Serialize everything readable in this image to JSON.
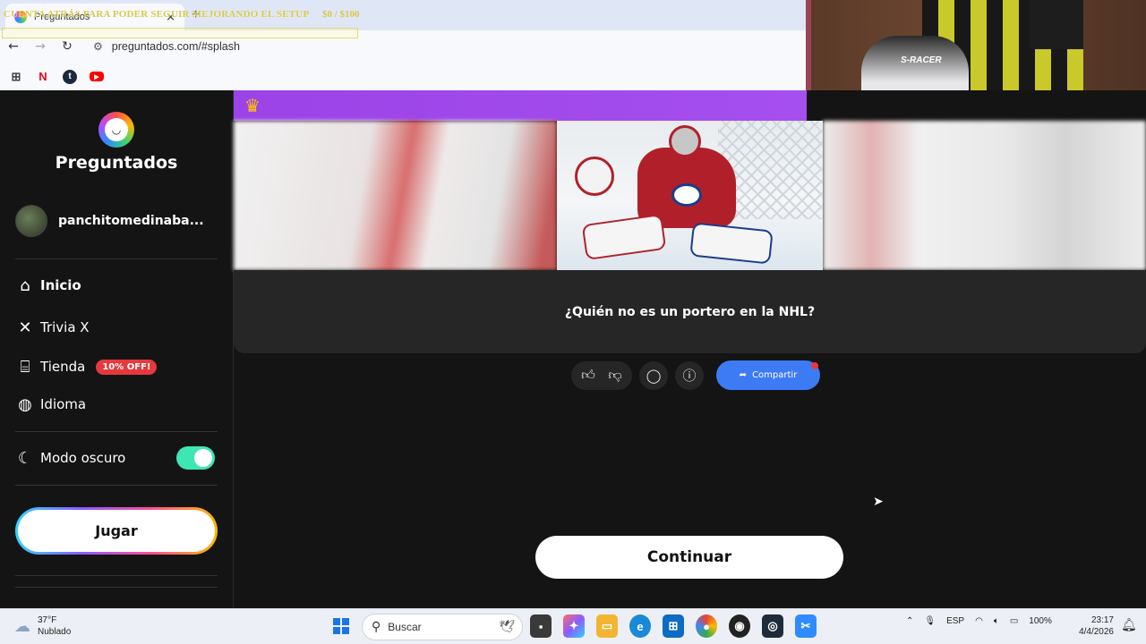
{
  "browser": {
    "tab_title": "Preguntados",
    "tab_close": "×",
    "new_tab": "+",
    "url": "preguntados.com/#splash",
    "overlay_text": "CUENTA ATRÁS PARA PODER SEGUIR MEJORANDO EL SETUP",
    "overlay_count": "$0 / $100",
    "nav": {
      "back": "←",
      "forward": "→",
      "reload": "↻",
      "site_info": "⚙"
    },
    "bookmarks": [
      {
        "name": "apps",
        "glyph": "⊞"
      },
      {
        "name": "netflix",
        "glyph": "N"
      },
      {
        "name": "tumblr",
        "glyph": "t"
      },
      {
        "name": "youtube",
        "glyph": "▶"
      }
    ]
  },
  "webcam": {
    "chair_brand": "S-RACER"
  },
  "sidebar": {
    "logo_text": "Preguntados",
    "username": "panchitomedinaba...",
    "nav": [
      {
        "label": "Inicio",
        "icon": "home-icon"
      },
      {
        "label": "Trivia X",
        "icon": "x-icon"
      },
      {
        "label": "Tienda",
        "icon": "store-icon",
        "badge": "10% OFF!"
      },
      {
        "label": "Idioma",
        "icon": "globe-icon"
      }
    ],
    "dark_mode_label": "Modo oscuro",
    "dark_mode_on": true,
    "play_label": "Jugar"
  },
  "main": {
    "question": "¿Quién no es un portero en la NHL?",
    "share_label": "Compartir",
    "continue_label": "Continuar"
  },
  "taskbar": {
    "weather_temp": "37°F",
    "weather_desc": "Nublado",
    "search_placeholder": "Buscar",
    "language": "ESP",
    "battery": "100%",
    "time": "23:17",
    "date": "4/4/2026"
  },
  "colors": {
    "accent_purple": "#9b43e6",
    "share_blue": "#3d7bf5",
    "toggle_green": "#3ee6b4",
    "promo_red": "#e6393e"
  }
}
